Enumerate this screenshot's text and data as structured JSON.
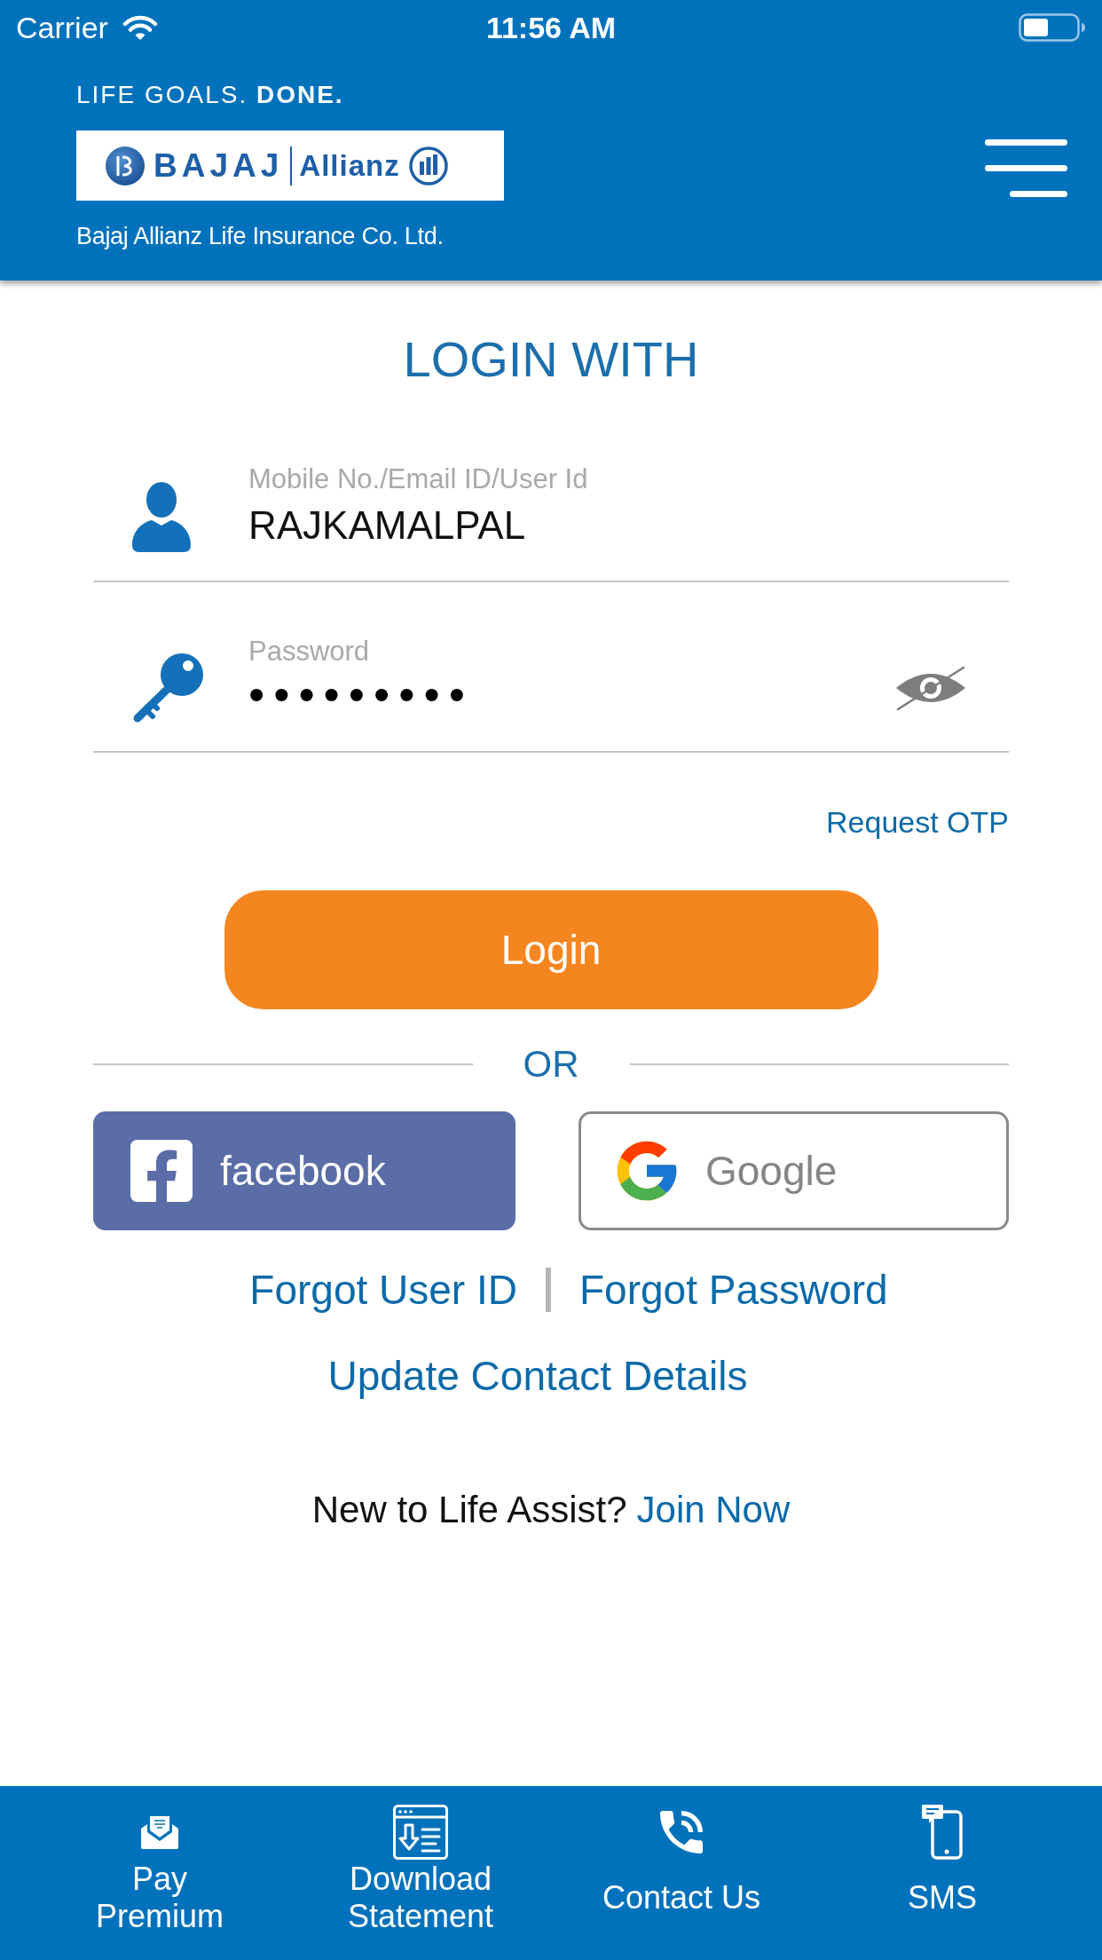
{
  "status_bar": {
    "carrier": "Carrier",
    "time": "11:56 AM"
  },
  "header": {
    "tagline": "LIFE GOALS. **DONE.**",
    "logo": {
      "brand": "BAJAJ",
      "partner": "Allianz"
    },
    "company": "Bajaj Allianz Life Insurance Co. Ltd."
  },
  "login": {
    "title": "LOGIN WITH",
    "fields": [
      {
        "kind": "user",
        "label": "Mobile No./Email ID/User Id",
        "value": "RAJKAMALPAL"
      },
      {
        "kind": "password",
        "label": "Password",
        "value": "•••••••••"
      }
    ],
    "request_otp": "Request OTP",
    "submit": "Login",
    "divider": "OR",
    "social": [
      {
        "kind": "facebook",
        "label": "facebook"
      },
      {
        "kind": "google",
        "label": "Google"
      }
    ],
    "help_links": [
      "Forgot User ID",
      "Forgot Password"
    ],
    "update_link": "Update Contact Details",
    "signup": {
      "prompt": "New to Life Assist?",
      "link": "Join Now"
    }
  },
  "bottom_nav": [
    {
      "kind": "pay",
      "label": "Pay Premium"
    },
    {
      "kind": "download",
      "label": "Download Statement"
    },
    {
      "kind": "contact",
      "label": "Contact Us"
    },
    {
      "kind": "sms",
      "label": "SMS"
    }
  ]
}
